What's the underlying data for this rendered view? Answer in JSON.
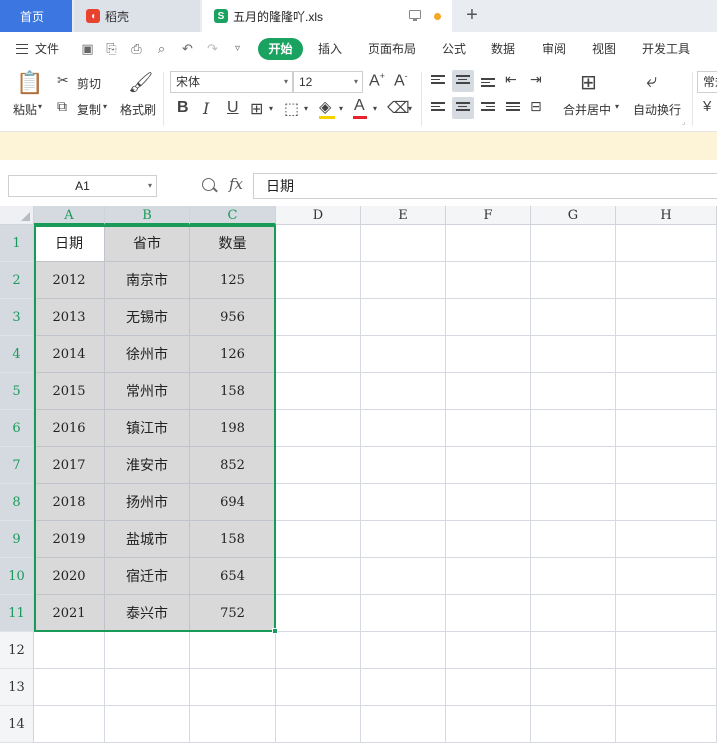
{
  "tabs": {
    "home": "首页",
    "doc1": "稻壳",
    "doc2": "五月的隆隆吖.xls",
    "doc1_icon": "daoke-icon",
    "doc2_icon": "spreadsheet-icon"
  },
  "menu": {
    "file": "文件",
    "start": "开始",
    "insert": "插入",
    "layout": "页面布局",
    "formula": "公式",
    "data": "数据",
    "review": "审阅",
    "view": "视图",
    "dev": "开发工具"
  },
  "ribbon": {
    "cut": "剪切",
    "copy": "复制",
    "paste": "粘贴",
    "format_painter": "格式刷",
    "font_name": "宋体",
    "font_size": "12",
    "merge_center": "合并居中",
    "wrap_text": "自动换行",
    "normal_partial": "常规"
  },
  "formula_bar": {
    "cell_ref": "A1",
    "fx": "fx",
    "content": "日期"
  },
  "columns": [
    "A",
    "B",
    "C",
    "D",
    "E",
    "F",
    "G",
    "H"
  ],
  "rows": [
    "1",
    "2",
    "3",
    "4",
    "5",
    "6",
    "7",
    "8",
    "9",
    "10",
    "11",
    "12",
    "13",
    "14"
  ],
  "table": [
    [
      "日期",
      "省市",
      "数量"
    ],
    [
      "2012",
      "南京市",
      "125"
    ],
    [
      "2013",
      "无锡市",
      "956"
    ],
    [
      "2014",
      "徐州市",
      "126"
    ],
    [
      "2015",
      "常州市",
      "158"
    ],
    [
      "2016",
      "镇江市",
      "198"
    ],
    [
      "2017",
      "淮安市",
      "852"
    ],
    [
      "2018",
      "扬州市",
      "694"
    ],
    [
      "2019",
      "盐城市",
      "158"
    ],
    [
      "2020",
      "宿迁市",
      "654"
    ],
    [
      "2021",
      "泰兴市",
      "752"
    ]
  ],
  "colors": {
    "accent_green": "#1a9a58",
    "home_tab": "#3b76e1",
    "selection_fill": "#d9d9d9",
    "notice": "#fdf3d6"
  }
}
